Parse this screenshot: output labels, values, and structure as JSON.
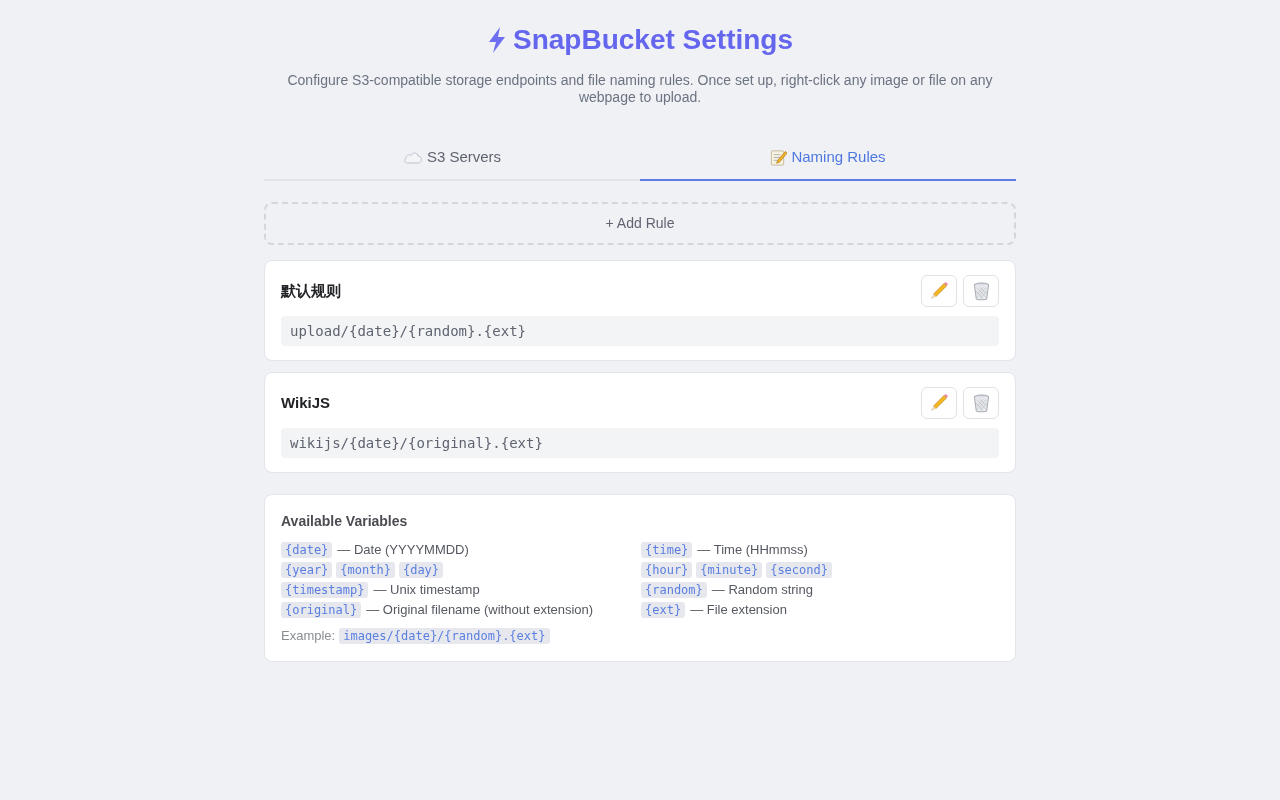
{
  "header": {
    "title": "SnapBucket Settings",
    "subtitle": "Configure S3-compatible storage endpoints and file naming rules. Once set up, right-click any image or file on any webpage to upload."
  },
  "tabs": [
    {
      "label": "S3 Servers",
      "selected": false
    },
    {
      "label": "Naming Rules",
      "selected": true
    }
  ],
  "add_button": {
    "label": "+ Add Rule"
  },
  "rules": [
    {
      "name": "默认规则",
      "pattern": "upload/{date}/{random}.{ext}"
    },
    {
      "name": "WikiJS",
      "pattern": "wikijs/{date}/{original}.{ext}"
    }
  ],
  "variables": {
    "title": "Available Variables",
    "items": [
      {
        "tokens": [
          "{date}"
        ],
        "description": "— Date (YYYYMMDD)"
      },
      {
        "tokens": [
          "{time}"
        ],
        "description": "— Time (HHmmss)"
      },
      {
        "tokens": [
          "{year}",
          "{month}",
          "{day}"
        ]
      },
      {
        "tokens": [
          "{hour}",
          "{minute}",
          "{second}"
        ]
      },
      {
        "tokens": [
          "{timestamp}"
        ],
        "description": "— Unix timestamp"
      },
      {
        "tokens": [
          "{random}"
        ],
        "description": "— Random string"
      },
      {
        "tokens": [
          "{original}"
        ],
        "description": "— Original filename (without extension)"
      },
      {
        "tokens": [
          "{ext}"
        ],
        "description": "— File extension"
      }
    ],
    "example": {
      "label": "Example:",
      "value": "images/{date}/{random}.{ext}"
    }
  }
}
